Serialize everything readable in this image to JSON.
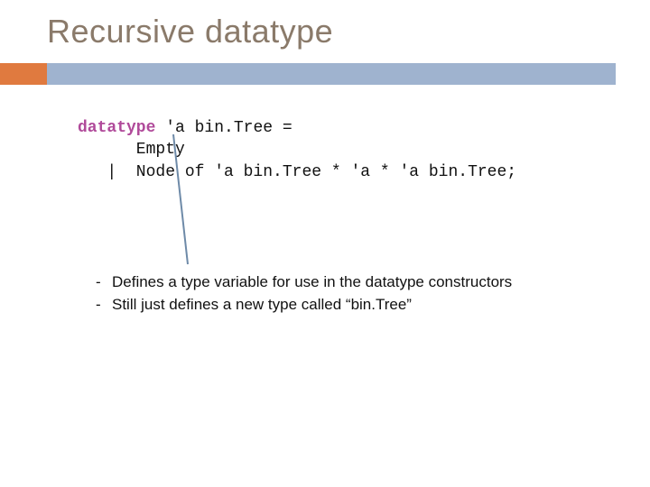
{
  "title": "Recursive datatype",
  "code": {
    "keyword": "datatype",
    "line1_rest": " 'a bin.Tree =",
    "line2": "      Empty",
    "line3": "   |  Node of 'a bin.Tree * 'a * 'a bin.Tree;"
  },
  "bullets": [
    "Defines a type variable for use in the datatype constructors",
    "Still just defines a new type called “bin.Tree”"
  ],
  "colors": {
    "title": "#8a7a6a",
    "bar": "#9fb3cf",
    "accent": "#e07a3f",
    "keyword": "#b04a9a",
    "annotation": "#6e8aa8"
  }
}
